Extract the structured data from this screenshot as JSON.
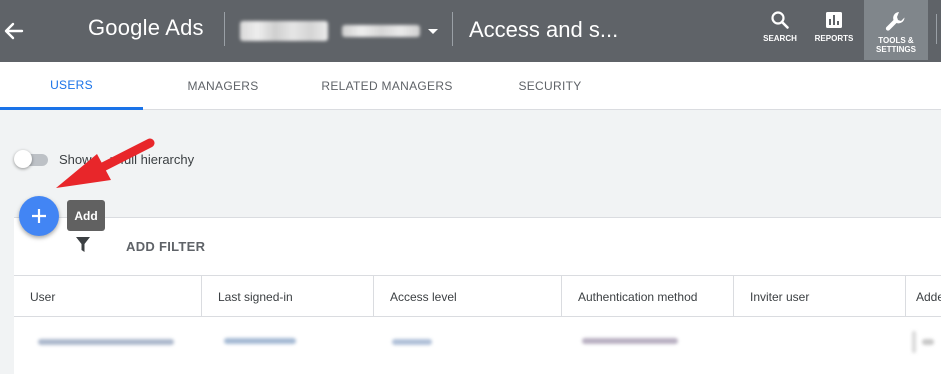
{
  "header": {
    "back_icon": "arrow-back-icon",
    "logo": "Google Ads",
    "account_dropdown_icon": "caret-down-icon",
    "page_title": "Access and s...",
    "tools": [
      {
        "icon": "search-icon",
        "label": "SEARCH"
      },
      {
        "icon": "bar-chart-icon",
        "label": "REPORTS"
      },
      {
        "icon": "wrench-icon",
        "label": "TOOLS & SETTINGS",
        "active": true
      }
    ]
  },
  "tabs": [
    {
      "label": "USERS",
      "active": true
    },
    {
      "label": "MANAGERS"
    },
    {
      "label": "RELATED MANAGERS"
    },
    {
      "label": "SECURITY"
    }
  ],
  "toggle": {
    "label": "Show ... n full hierarchy",
    "on": false
  },
  "fab": {
    "icon": "plus-icon",
    "tooltip": "Add"
  },
  "filter": {
    "icon": "filter-icon",
    "label": "ADD FILTER"
  },
  "table": {
    "columns": [
      "User",
      "Last signed-in",
      "Access level",
      "Authentication method",
      "Inviter user",
      "Adde"
    ]
  },
  "annotation": {
    "icon": "red-arrow-icon",
    "color": "#e8262a"
  },
  "colors": {
    "header": "#5f6368",
    "accent": "#1a73e8",
    "fab": "#4285f4"
  }
}
